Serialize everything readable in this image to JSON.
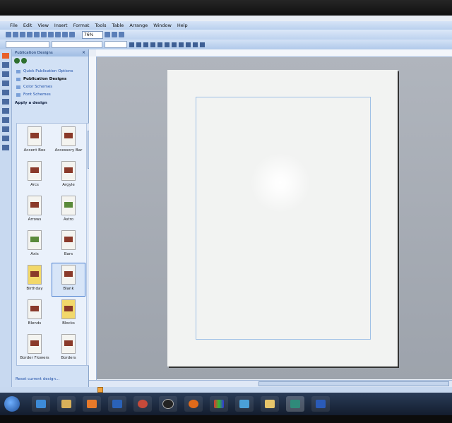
{
  "menu": [
    "File",
    "Edit",
    "View",
    "Insert",
    "Format",
    "Tools",
    "Table",
    "Arrange",
    "Window",
    "Help"
  ],
  "toolbar": {
    "zoom": "76%"
  },
  "taskpane": {
    "title": "Publication Designs",
    "close": "×",
    "links": [
      {
        "label": "Quick Publication Options",
        "active": false
      },
      {
        "label": "Publication Designs",
        "active": true
      },
      {
        "label": "Color Schemes",
        "active": false
      },
      {
        "label": "Font Schemes",
        "active": false
      }
    ],
    "section_title": "Apply a design",
    "designs": [
      "Accent Box",
      "Accessory Bar",
      "Arcs",
      "Argyle",
      "Arrows",
      "Astro",
      "Axis",
      "Bars",
      "Birthday",
      "Blank",
      "Blends",
      "Blocks",
      "Border Flowers",
      "Borders"
    ],
    "selected_design": "Blank",
    "reset_link": "Reset current design..."
  },
  "taskbar": {
    "items": [
      "internet-explorer",
      "file-explorer",
      "media-player",
      "outlook",
      "chrome",
      "hp",
      "firefox",
      "paint",
      "photo-viewer",
      "folder",
      "publisher",
      "word"
    ],
    "active_item": "publisher"
  },
  "colors": {
    "accent": "#1e4fa8",
    "page": "#f2f3f2",
    "canvas": "#a7adb6"
  }
}
